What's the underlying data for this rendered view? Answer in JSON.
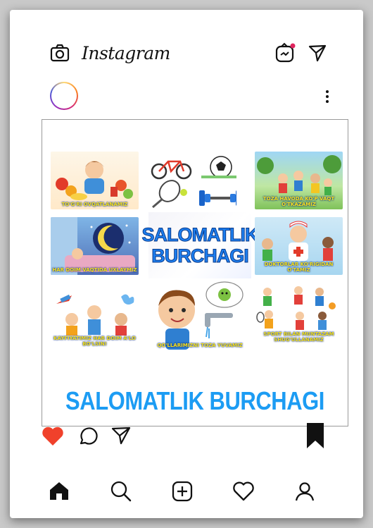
{
  "app": {
    "name": "Instagram"
  },
  "header_icons": [
    "camera-icon",
    "igtv-icon",
    "send-icon"
  ],
  "post": {
    "center_title_line1": "SALOMATLIK",
    "center_title_line2": "BURCHAGI",
    "main_caption": "SALOMATLIK BURCHAGI",
    "tiles": [
      {
        "caption": "TO'G'RI OVQATLANAMIZ"
      },
      {
        "caption": ""
      },
      {
        "caption": "TOZA HAVODA KO'P VAQT O'TKAZAMIZ"
      },
      {
        "caption": "HAR DOIM VAQTIDA UXLAYMIZ"
      },
      {
        "caption": ""
      },
      {
        "caption": "DOKTORLAR KO'RIGIDAN O'TAMIZ"
      },
      {
        "caption": "KAYFIYATIMIZ HAR DOIM A'LO BO'LSIN!"
      },
      {
        "caption": "QO'LLARIMIZNI TOZA YUVAMIZ"
      },
      {
        "caption": "SPORT BILAN MUNTAZAM SHUG'ULLANAMIZ"
      }
    ]
  },
  "colors": {
    "like": "#f0412b",
    "accent": "#1c9cf3",
    "bookmark": "#111111"
  },
  "bottom_nav": [
    "home-icon",
    "search-icon",
    "add-post-icon",
    "activity-heart-icon",
    "profile-icon"
  ]
}
